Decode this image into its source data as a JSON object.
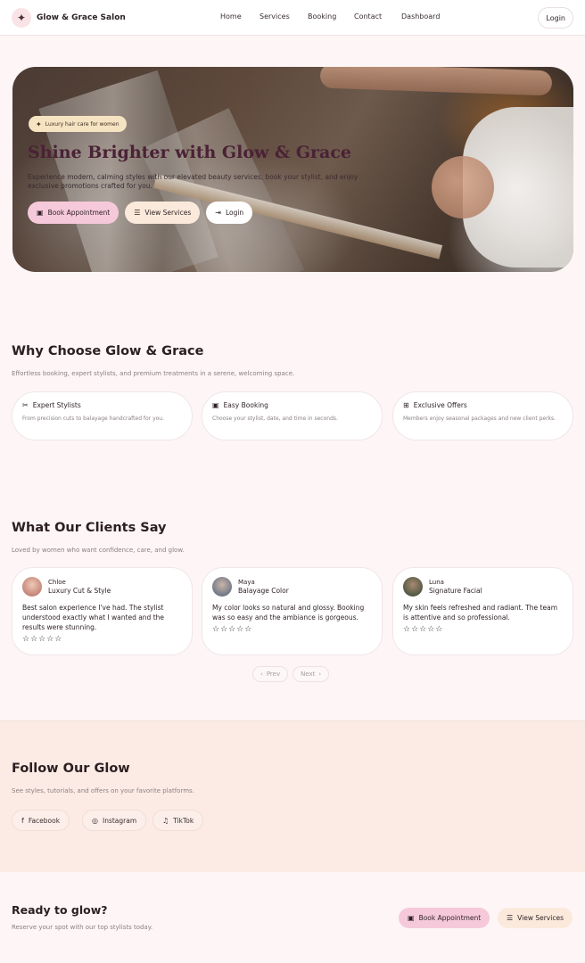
{
  "header": {
    "brand": "Glow & Grace Salon",
    "nav": [
      "Home",
      "Services",
      "Booking",
      "Contact",
      "Dashboard"
    ],
    "login": "Login"
  },
  "hero": {
    "badge": "Luxury hair care for women",
    "title": "Shine Brighter with Glow & Grace",
    "subtitle": "Experience modern, calming styles with our elevated beauty services, book your stylist, and enjoy exclusive promotions crafted for you.",
    "actions": {
      "book": "Book Appointment",
      "services": "View Services",
      "login": "Login"
    }
  },
  "why": {
    "title": "Why Choose Glow & Grace",
    "subtitle": "Effortless booking, expert stylists, and premium treatments in a serene, welcoming space.",
    "features": [
      {
        "title": "Expert Stylists",
        "desc": "From precision cuts to balayage handcrafted for you.",
        "icon": "scissors-icon"
      },
      {
        "title": "Easy Booking",
        "desc": "Choose your stylist, date, and time in seconds.",
        "icon": "calendar-icon"
      },
      {
        "title": "Exclusive Offers",
        "desc": "Members enjoy seasonal packages and new client perks.",
        "icon": "gift-icon"
      }
    ]
  },
  "clients": {
    "title": "What Our Clients Say",
    "subtitle": "Loved by women who want confidence, care, and glow.",
    "reviews": [
      {
        "name": "Chloe",
        "service": "Luxury Cut & Style",
        "text": "Best salon experience I've had. The stylist understood exactly what I wanted and the results were stunning.",
        "stars": "☆☆☆☆☆",
        "avatar_color": "#d99a8a"
      },
      {
        "name": "Maya",
        "service": "Balayage Color",
        "text": "My color looks so natural and glossy. Booking was so easy and the ambiance is gorgeous.",
        "stars": "☆☆☆☆☆",
        "avatar_color": "#6a7d96"
      },
      {
        "name": "Luna",
        "service": "Signature Facial",
        "text": "My skin feels refreshed and radiant. The team is attentive and so professional.",
        "stars": "☆☆☆☆☆",
        "avatar_color": "#3f5a3d"
      }
    ],
    "prev": "Prev",
    "next": "Next"
  },
  "follow": {
    "title": "Follow Our Glow",
    "subtitle": "See styles, tutorials, and offers on your favorite platforms.",
    "links": {
      "facebook": "Facebook",
      "instagram": "Instagram",
      "tiktok": "TikTok"
    }
  },
  "cta": {
    "title": "Ready to glow?",
    "subtitle": "Reserve your spot with our top stylists today.",
    "book": "Book Appointment",
    "services": "View Services"
  }
}
